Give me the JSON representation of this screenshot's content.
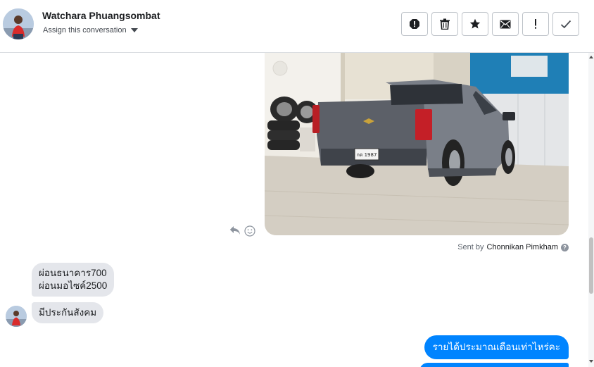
{
  "header": {
    "contact_name": "Watchara Phuangsombat",
    "assign_label": "Assign this conversation",
    "actions": [
      "spam-icon",
      "trash-icon",
      "star-icon",
      "envelope-icon",
      "exclamation-icon",
      "check-icon"
    ]
  },
  "conversation": {
    "sent_by_prefix": "Sent by",
    "sent_by_name": "Chonnikan Pimkham",
    "help_glyph": "?",
    "incoming": [
      {
        "lines": [
          "ผ่อนธนาคาร700",
          "ผ่อนมอไซค์2500"
        ]
      },
      {
        "lines": [
          "มีประกันสังคม"
        ]
      }
    ],
    "outgoing": [
      {
        "text": "รายได้ประมาณเดือนเท่าไหร่คะ"
      },
      {
        "text": ""
      }
    ]
  },
  "colors": {
    "accent": "#0084ff",
    "incoming_bubble": "#e4e6eb",
    "border": "#bec3c9"
  }
}
